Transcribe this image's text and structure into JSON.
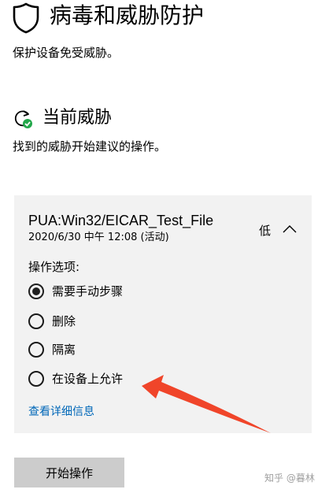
{
  "header": {
    "title": "病毒和威胁防护",
    "subtitle": "保护设备免受威胁。",
    "icon": "shield-icon"
  },
  "section": {
    "title": "当前威胁",
    "description": "找到的威胁开始建议的操作。",
    "icon": "refresh-check-icon"
  },
  "threat": {
    "name": "PUA:Win32/EICAR_Test_File",
    "date": "2020/6/30 中午 12:08  (活动)",
    "severity": "低",
    "options_label": "操作选项:",
    "options": [
      {
        "label": "需要手动步骤",
        "checked": true
      },
      {
        "label": "删除",
        "checked": false
      },
      {
        "label": "隔离",
        "checked": false
      },
      {
        "label": "在设备上允许",
        "checked": false
      }
    ],
    "details_link": "查看详细信息"
  },
  "actions": {
    "start_button": "开始操作"
  },
  "watermark": "知乎 @暮林",
  "colors": {
    "link": "#0067b8",
    "card_bg": "#f2f2f2",
    "button_bg": "#cccccc",
    "arrow": "#f0452a",
    "status_green": "#22a74a"
  }
}
